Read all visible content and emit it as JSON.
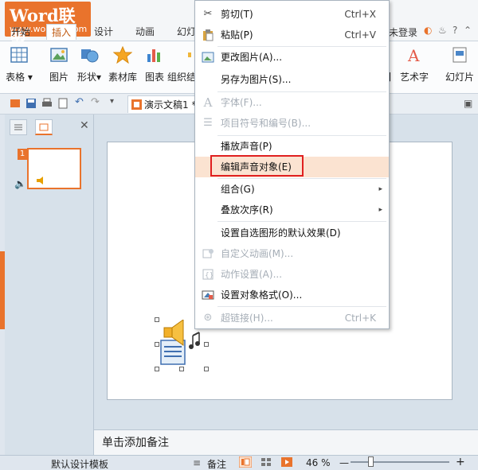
{
  "logo": {
    "main_a": "Word",
    "main_b": "联盟",
    "sub": "www.wordlm.com"
  },
  "tabs": [
    {
      "label": "开始",
      "active": false
    },
    {
      "label": "插入",
      "active": true
    },
    {
      "label": "设计",
      "active": false
    },
    {
      "label": "动画",
      "active": false
    },
    {
      "label": "幻灯",
      "active": false
    }
  ],
  "login_label": "未登录",
  "ribbon_tools": [
    {
      "label": "表格",
      "icon": "table-icon"
    },
    {
      "label": "图片",
      "icon": "picture-icon"
    },
    {
      "label": "形状",
      "icon": "shapes-icon"
    },
    {
      "label": "素材库",
      "icon": "star-icon"
    },
    {
      "label": "图表",
      "icon": "chart-icon"
    },
    {
      "label": "组织结",
      "icon": "org-chart-icon"
    },
    {
      "label": "艺术字",
      "icon": "art-text-icon"
    },
    {
      "label": "幻灯片",
      "icon": "slide-icon"
    }
  ],
  "document_tab": {
    "title": "演示文稿1 *"
  },
  "context_menu": {
    "items": [
      {
        "label": "剪切(T)",
        "shortcut": "Ctrl+X",
        "disabled": false,
        "icon": "scissors-icon"
      },
      {
        "label": "粘贴(P)",
        "shortcut": "Ctrl+V",
        "disabled": false,
        "icon": "paste-icon"
      },
      {
        "label": "更改图片(A)...",
        "shortcut": "",
        "disabled": false,
        "icon": "change-picture-icon"
      },
      {
        "label": "另存为图片(S)...",
        "shortcut": "",
        "disabled": false,
        "icon": ""
      },
      {
        "label": "字体(F)...",
        "shortcut": "",
        "disabled": true,
        "icon": "font-icon"
      },
      {
        "label": "项目符号和编号(B)...",
        "shortcut": "",
        "disabled": true,
        "icon": "bullets-icon"
      },
      {
        "label": "播放声音(P)",
        "shortcut": "",
        "disabled": false,
        "icon": ""
      },
      {
        "label": "编辑声音对象(E)",
        "shortcut": "",
        "disabled": false,
        "icon": "",
        "highlighted": true
      },
      {
        "label": "组合(G)",
        "shortcut": "",
        "disabled": false,
        "icon": "",
        "submenu": true
      },
      {
        "label": "叠放次序(R)",
        "shortcut": "",
        "disabled": false,
        "icon": "",
        "submenu": true
      },
      {
        "label": "设置自选图形的默认效果(D)",
        "shortcut": "",
        "disabled": false,
        "icon": ""
      },
      {
        "label": "自定义动画(M)...",
        "shortcut": "",
        "disabled": true,
        "icon": "custom-animation-icon"
      },
      {
        "label": "动作设置(A)...",
        "shortcut": "",
        "disabled": true,
        "icon": "action-settings-icon"
      },
      {
        "label": "设置对象格式(O)...",
        "shortcut": "",
        "disabled": false,
        "icon": "format-object-icon"
      },
      {
        "label": "超链接(H)...",
        "shortcut": "Ctrl+K",
        "disabled": true,
        "icon": "hyperlink-icon"
      }
    ]
  },
  "slide_panel": {
    "slide_number": "1"
  },
  "notes_placeholder": "单击添加备注",
  "status": {
    "template": "默认设计模板",
    "notes_label": "备注",
    "zoom": "46 %"
  },
  "colors": {
    "accent": "#e9732c",
    "menu_hover": "#fbe3d1",
    "highlight_box": "#e02020"
  }
}
